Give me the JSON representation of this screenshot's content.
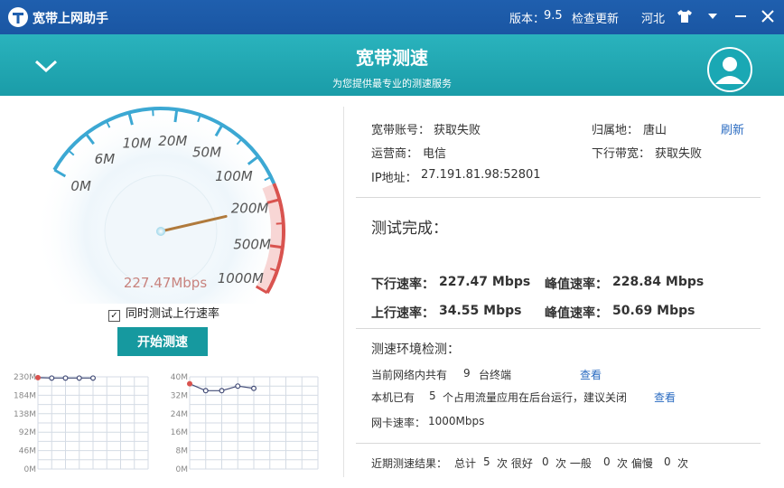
{
  "titlebar": {
    "app_name": "宽带上网助手",
    "version_label": "版本：",
    "version": "9.5",
    "check_update": "检查更新",
    "region": "河北"
  },
  "header": {
    "title": "宽带测速",
    "subtitle": "为您提供最专业的测速服务"
  },
  "gauge": {
    "labels": [
      "0M",
      "6M",
      "10M",
      "20M",
      "50M",
      "100M",
      "200M",
      "500M",
      "1000M"
    ],
    "value_text": "227.47Mbps",
    "value_mbps": 227.47
  },
  "upload_checkbox": {
    "label": "同时测试上行速率",
    "checked": true
  },
  "start_button": "开始测速",
  "charts": {
    "download": {
      "y_ticks": [
        "230M",
        "184M",
        "138M",
        "92M",
        "46M",
        "0M"
      ],
      "ylim": [
        0,
        230
      ],
      "values": [
        228,
        227,
        227,
        227,
        227
      ],
      "color": "#444d78"
    },
    "upload": {
      "y_ticks": [
        "40M",
        "32M",
        "24M",
        "16M",
        "8M",
        "0M"
      ],
      "ylim": [
        0,
        40
      ],
      "values": [
        37,
        34,
        34,
        36,
        35
      ],
      "color": "#444d78"
    }
  },
  "info": {
    "account_label": "宽带账号：",
    "account_value": "获取失败",
    "location_label": "归属地：",
    "location_value": "唐山",
    "refresh": "刷新",
    "isp_label": "运营商：",
    "isp_value": "电信",
    "bandwidth_label": "下行带宽：",
    "bandwidth_value": "获取失败",
    "ip_label": "IP地址：",
    "ip_value": "27.191.81.98:52801"
  },
  "result": {
    "title": "测试完成：",
    "down_label": "下行速率：",
    "down_value": "227.47 Mbps",
    "down_peak_label": "峰值速率：",
    "down_peak_value": "228.84 Mbps",
    "up_label": "上行速率：",
    "up_value": "34.55 Mbps",
    "up_peak_label": "峰值速率：",
    "up_peak_value": "50.69 Mbps"
  },
  "env": {
    "title": "测速环境检测：",
    "line1_prefix": "当前网络内共有",
    "line1_count": "9",
    "line1_suffix": "台终端",
    "line1_link": "查看",
    "line2_prefix": "本机已有",
    "line2_count": "5",
    "line2_suffix": "个占用流量应用在后台运行，建议关闭",
    "line2_link": "查看",
    "nic_label": "网卡速率：",
    "nic_value": "1000Mbps"
  },
  "history": {
    "label": "近期测速结果：",
    "total_label": "总计",
    "total": "5",
    "good_label": "次  很好",
    "good": "0",
    "normal_label": "次  一般",
    "normal": "0",
    "slow_label": "次  偏慢",
    "slow": "0",
    "unit": "次"
  }
}
